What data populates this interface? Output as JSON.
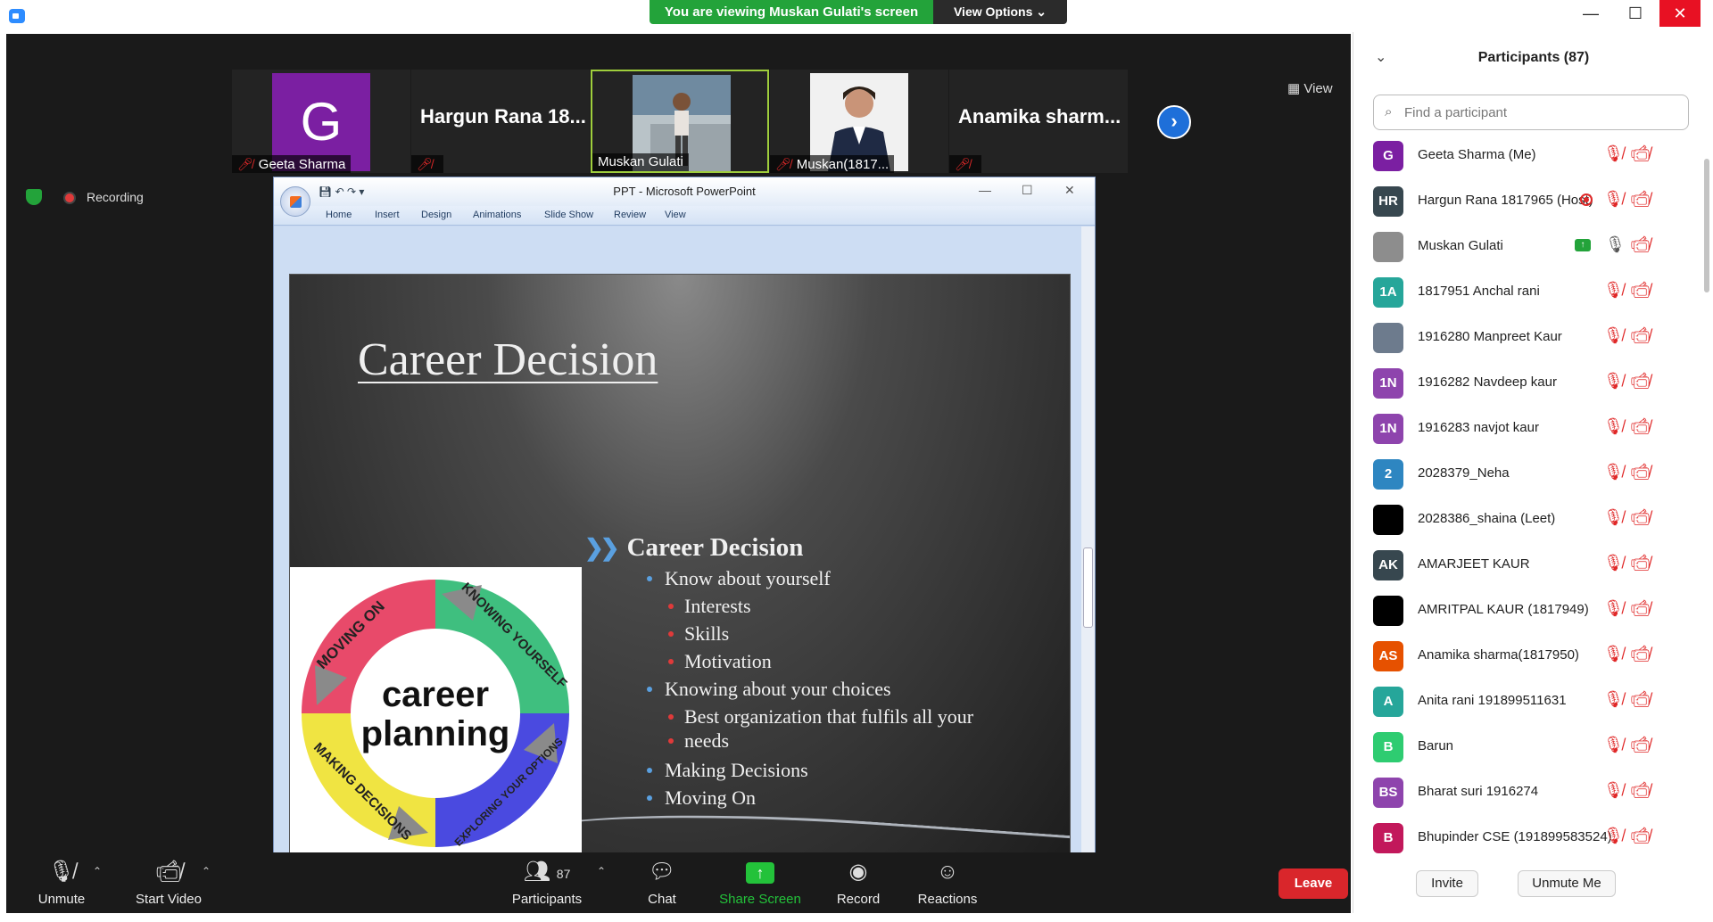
{
  "banner": {
    "viewing": "You are viewing Muskan Gulati's screen",
    "view_options": "View Options ⌄"
  },
  "window_controls": {
    "minimize": "—",
    "maximize": "☐",
    "close": "✕"
  },
  "thumbnails": {
    "geeta": {
      "initial": "G",
      "name": "Geeta Sharma"
    },
    "hargun": {
      "big_name": "Hargun Rana 18..."
    },
    "muskan": {
      "name": "Muskan Gulati"
    },
    "muskan2": {
      "name": "Muskan(1817..."
    },
    "anamika": {
      "big_name": "Anamika  sharm..."
    },
    "next": "›"
  },
  "view_button": "View",
  "recording_label": "Recording",
  "ppt": {
    "title": "PPT - Microsoft PowerPoint",
    "ribbon_tabs": [
      "Home",
      "Insert",
      "Design",
      "Animations",
      "Slide Show",
      "Review",
      "View"
    ],
    "slide": {
      "title": "Career Decision",
      "main_bullet": "Career Decision",
      "items": [
        {
          "level": 1,
          "text": "Know about yourself"
        },
        {
          "level": 2,
          "text": "Interests"
        },
        {
          "level": 2,
          "text": "Skills"
        },
        {
          "level": 2,
          "text": "Motivation"
        },
        {
          "level": 1,
          "text": "Knowing about your choices"
        },
        {
          "level": 2,
          "text": "Best organization that fulfils all your"
        },
        {
          "level": 2,
          "text": "needs"
        },
        {
          "level": 1,
          "text": "Making  Decisions"
        },
        {
          "level": 1,
          "text": "Moving On"
        }
      ],
      "image": {
        "center_line1": "career",
        "center_line2": "planning",
        "segments": [
          "MOVING ON",
          "KNOWING YOURSELF",
          "EXPLORING YOUR OPTIONS",
          "MAKING DECISIONS"
        ]
      }
    }
  },
  "controls": {
    "unmute": "Unmute",
    "start_video": "Start Video",
    "participants": "Participants",
    "participants_count": "87",
    "chat": "Chat",
    "share_screen": "Share Screen",
    "record": "Record",
    "reactions": "Reactions",
    "leave": "Leave"
  },
  "panel": {
    "title": "Participants (87)",
    "search_placeholder": "Find a participant",
    "participants": [
      {
        "initials": "G",
        "name": "Geeta Sharma (Me)",
        "color": "#7b1fa2"
      },
      {
        "initials": "HR",
        "name": "Hargun Rana 1817965 (Host)",
        "color": "#37474f",
        "recording": true
      },
      {
        "initials": "",
        "name": "Muskan Gulati",
        "color": "#8d8d8d",
        "sharing": true,
        "mic_on": true
      },
      {
        "initials": "1A",
        "name": "1817951 Anchal rani",
        "color": "#26a69a"
      },
      {
        "initials": "",
        "name": "1916280 Manpreet Kaur",
        "color": "#6d7b8d"
      },
      {
        "initials": "1N",
        "name": "1916282 Navdeep kaur",
        "color": "#8e44ad"
      },
      {
        "initials": "1N",
        "name": "1916283 navjot kaur",
        "color": "#8e44ad"
      },
      {
        "initials": "2",
        "name": "2028379_Neha",
        "color": "#2e86c1"
      },
      {
        "initials": "",
        "name": "2028386_shaina (Leet)",
        "color": "#000000"
      },
      {
        "initials": "AK",
        "name": "AMARJEET KAUR",
        "color": "#37474f"
      },
      {
        "initials": "",
        "name": "AMRITPAL KAUR (1817949)",
        "color": "#000000"
      },
      {
        "initials": "AS",
        "name": "Anamika sharma(1817950)",
        "color": "#e65100"
      },
      {
        "initials": "A",
        "name": "Anita rani 191899511631",
        "color": "#26a69a"
      },
      {
        "initials": "B",
        "name": "Barun",
        "color": "#2ecc71"
      },
      {
        "initials": "BS",
        "name": "Bharat suri 1916274",
        "color": "#8e44ad"
      },
      {
        "initials": "B",
        "name": "Bhupinder CSE (191899583524)",
        "color": "#c2185b"
      }
    ],
    "invite": "Invite",
    "unmute_me": "Unmute Me"
  }
}
